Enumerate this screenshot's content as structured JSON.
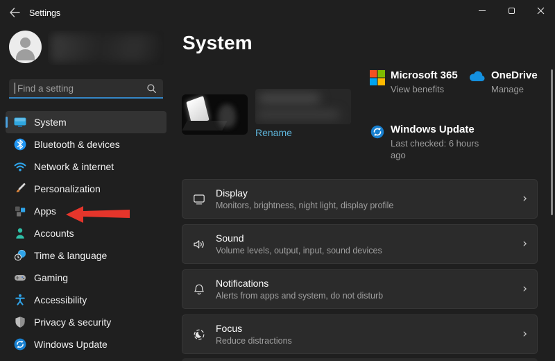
{
  "titlebar": {
    "title": "Settings"
  },
  "sidebar": {
    "search_placeholder": "Find a setting",
    "items": [
      {
        "label": "System",
        "icon": "system-display-icon",
        "active": true
      },
      {
        "label": "Bluetooth & devices",
        "icon": "bluetooth-icon",
        "active": false
      },
      {
        "label": "Network & internet",
        "icon": "network-wifi-icon",
        "active": false
      },
      {
        "label": "Personalization",
        "icon": "personalization-brush-icon",
        "active": false
      },
      {
        "label": "Apps",
        "icon": "apps-grid-icon",
        "active": false
      },
      {
        "label": "Accounts",
        "icon": "accounts-person-icon",
        "active": false
      },
      {
        "label": "Time & language",
        "icon": "time-language-icon",
        "active": false
      },
      {
        "label": "Gaming",
        "icon": "gaming-gamepad-icon",
        "active": false
      },
      {
        "label": "Accessibility",
        "icon": "accessibility-person-icon",
        "active": false
      },
      {
        "label": "Privacy & security",
        "icon": "privacy-shield-icon",
        "active": false
      },
      {
        "label": "Windows Update",
        "icon": "windows-update-icon",
        "active": false
      }
    ]
  },
  "main": {
    "page_title": "System",
    "device": {
      "rename_label": "Rename"
    },
    "quick_info": {
      "microsoft365": {
        "title": "Microsoft 365",
        "subtitle": "View benefits",
        "icon": "microsoft-logo"
      },
      "onedrive": {
        "title": "OneDrive",
        "subtitle": "Manage",
        "icon": "onedrive-cloud-icon"
      },
      "windows_update": {
        "title": "Windows Update",
        "subtitle": "Last checked: 6 hours ago",
        "icon": "windows-update-icon"
      }
    },
    "cards": [
      {
        "title": "Display",
        "subtitle": "Monitors, brightness, night light, display profile",
        "icon": "display-outline-icon"
      },
      {
        "title": "Sound",
        "subtitle": "Volume levels, output, input, sound devices",
        "icon": "speaker-icon"
      },
      {
        "title": "Notifications",
        "subtitle": "Alerts from apps and system, do not disturb",
        "icon": "bell-icon"
      },
      {
        "title": "Focus",
        "subtitle": "Reduce distractions",
        "icon": "focus-crescent-icon"
      }
    ]
  },
  "annotation": {
    "type": "red-arrow",
    "points_to": "Apps",
    "color": "#e5352b"
  },
  "colors": {
    "window_bg": "#1f1f1f",
    "card_bg": "#2b2b2b",
    "accent": "#4ba0dd",
    "link": "#5db2d7",
    "subtitle_gray": "#9f9f9f",
    "arrow_red": "#e5352b"
  }
}
